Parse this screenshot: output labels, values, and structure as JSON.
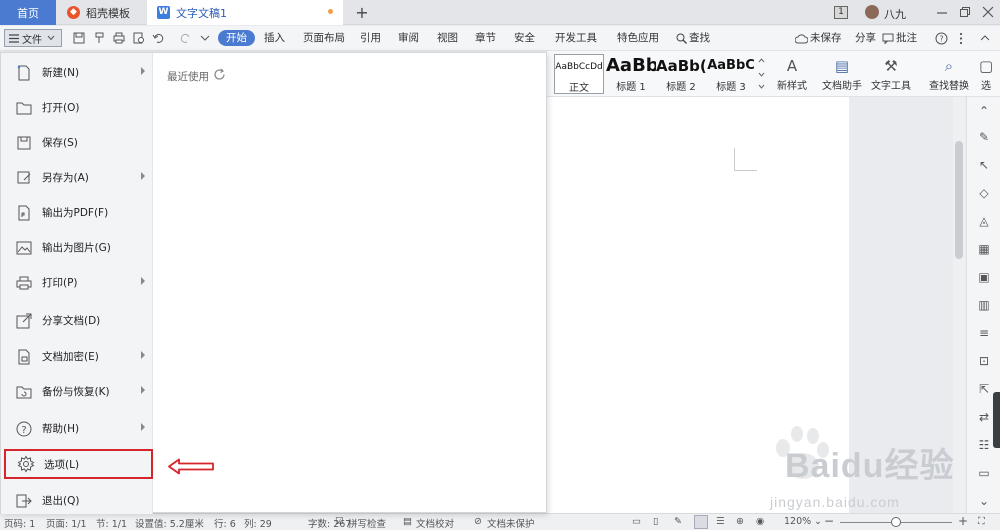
{
  "tabs": {
    "home": "首页",
    "templates": "稻壳模板",
    "document": "文字文稿1"
  },
  "window": {
    "badge": "1",
    "username": "八九"
  },
  "file_button": "文件",
  "ribbon_tabs": [
    "开始",
    "插入",
    "页面布局",
    "引用",
    "审阅",
    "视图",
    "章节",
    "安全",
    "开发工具",
    "特色应用",
    "查找"
  ],
  "ribbon_right": {
    "unsaved": "未保存",
    "share": "分享",
    "comment": "批注"
  },
  "styles": [
    {
      "preview": "AaBbCcDd",
      "label": "正文"
    },
    {
      "preview": "AaBb",
      "label": "标题 1"
    },
    {
      "preview": "AaBb(",
      "label": "标题 2"
    },
    {
      "preview": "AaBbC",
      "label": "标题 3"
    }
  ],
  "ribbon_tools": {
    "new_style": "新样式",
    "doc_assistant": "文档助手",
    "text_tools": "文字工具",
    "find_replace": "查找替换",
    "select": "选"
  },
  "file_menu": {
    "items": [
      {
        "label": "新建(N)",
        "icon": "new-doc-icon",
        "submenu": true
      },
      {
        "label": "打开(O)",
        "icon": "folder-icon",
        "submenu": false
      },
      {
        "label": "保存(S)",
        "icon": "save-icon",
        "submenu": false
      },
      {
        "label": "另存为(A)",
        "icon": "save-as-icon",
        "submenu": true
      },
      {
        "label": "输出为PDF(F)",
        "icon": "pdf-icon",
        "submenu": false
      },
      {
        "label": "输出为图片(G)",
        "icon": "image-icon",
        "submenu": false
      },
      {
        "label": "打印(P)",
        "icon": "printer-icon",
        "submenu": true
      },
      {
        "label": "分享文档(D)",
        "icon": "share-icon",
        "submenu": false
      },
      {
        "label": "文档加密(E)",
        "icon": "lock-doc-icon",
        "submenu": true
      },
      {
        "label": "备份与恢复(K)",
        "icon": "backup-icon",
        "submenu": true
      },
      {
        "label": "帮助(H)",
        "icon": "help-icon",
        "submenu": true
      },
      {
        "label": "选项(L)",
        "icon": "gear-icon",
        "submenu": false,
        "highlighted": true
      },
      {
        "label": "退出(Q)",
        "icon": "exit-icon",
        "submenu": false
      }
    ],
    "recent_title": "最近使用"
  },
  "statusbar": {
    "page": "页码: 1",
    "pages": "页面: 1/1",
    "section": "节: 1/1",
    "setting": "设置值: 5.2厘米",
    "row": "行: 6",
    "col": "列: 29",
    "words": "字数: 267",
    "spell": "拼写检查",
    "proof": "文档校对",
    "protect": "文档未保护",
    "zoom": "120%"
  },
  "watermark": {
    "text": "Baidu经验",
    "url": "jingyan.baidu.com"
  },
  "colors": {
    "accent": "#4b7bd1",
    "highlight": "#d5252b"
  }
}
